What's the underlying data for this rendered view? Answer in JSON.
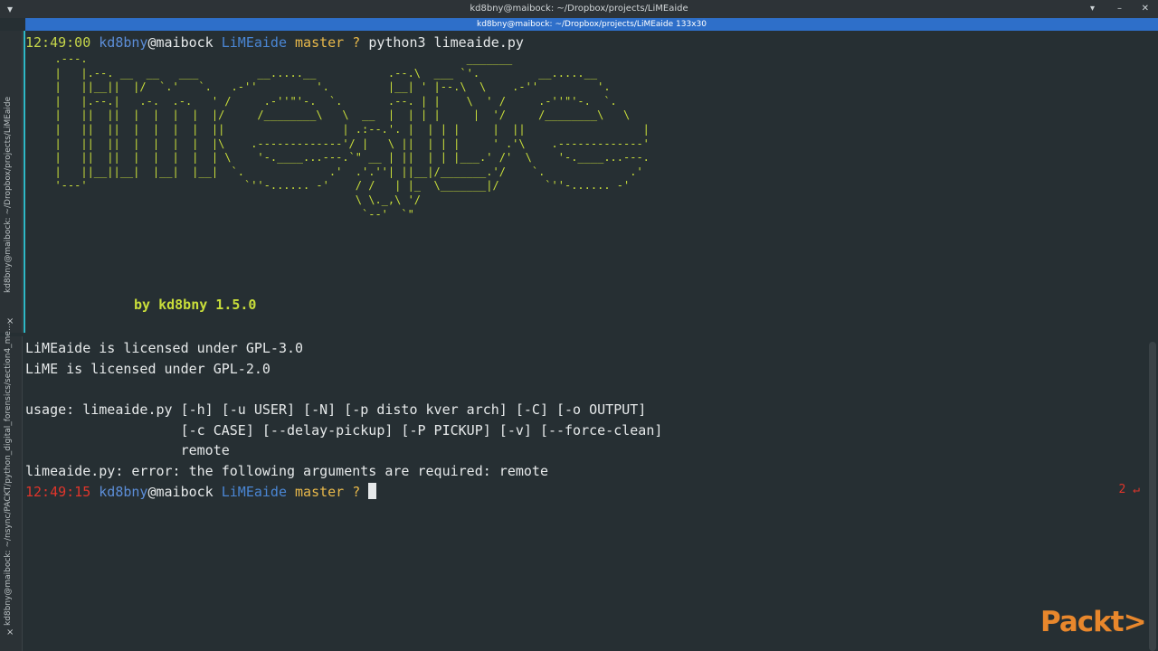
{
  "window": {
    "title": "kd8bny@maibock: ~/Dropbox/projects/LiMEaide",
    "controls": [
      "▾",
      "–",
      "✕"
    ]
  },
  "tab": {
    "title": "kd8bny@maibock: ~/Dropbox/projects/LiMEaide 133x30"
  },
  "sidebar": {
    "top_label": "kd8bny@maibock: ~/Dropbox/projects/LiMEaide",
    "bottom_label": "kd8bny@maibock: ~/nsync/PACKT/python_digital_forensics/section4_me...",
    "close_glyph": "×"
  },
  "prompt1": {
    "time": "12:49:00",
    "user": "kd8bny",
    "at_host": "@maibock",
    "dir": "LiMEaide",
    "branch": "master",
    "status": "?",
    "command": "python3 limeaide.py"
  },
  "banner": {
    "ascii": "  .---.                                                          _______\n  |   |.--. __  __   ___         __.....__           .--.\\  ___ `'.         __.....__\n  |   ||__||  |/  `.'   `.   .-''         '.         |__| ' |--.\\  \\    .-''         '.\n  |   |.--.|   .-.  .-.   ' /     .-''\"'-.  `.       .--. | |    \\  ' /     .-''\"'-.  `.\n  |   ||  ||  |  |  |  |  |/     /________\\   \\  __  |  | | |     |  '/     /________\\   \\\n  |   ||  ||  |  |  |  |  ||                  | .:--.'. |  | | |     |  ||                  |\n  |   ||  ||  |  |  |  |  |\\    .-------------'/ |   \\ ||  | | |     ' .'\\    .-------------'\n  |   ||  ||  |  |  |  |  | \\    '-.____...---.`\" __ | ||  | | |___.' /'  \\    '-.____...---.\n  |   ||__||__|  |__|  |__|  `.             .'  .'.''| ||__|/_______.'/    `.             .'\n  '---'                        `''-...... -'    / /   | |_  \\_______|/       `''-...... -'\n                                                \\ \\._,\\ '/\n                                                 `--'  `\"",
    "byline": "by kd8bny 1.5.0"
  },
  "output": {
    "license1": "LiMEaide is licensed under GPL-3.0",
    "license2": "LiME is licensed under GPL-2.0",
    "usage1": "usage: limeaide.py [-h] [-u USER] [-N] [-p disto kver arch] [-C] [-o OUTPUT]",
    "usage2": "                   [-c CASE] [--delay-pickup] [-P PICKUP] [-v] [--force-clean]",
    "usage3": "                   remote",
    "error": "limeaide.py: error: the following arguments are required: remote"
  },
  "prompt2": {
    "time": "12:49:15",
    "user": "kd8bny",
    "at_host": "@maibock",
    "dir": "LiMEaide",
    "branch": "master",
    "status": "?",
    "exit_code": "2 ↵"
  },
  "watermark": {
    "logo_text": "Packt>"
  },
  "colors": {
    "background": "#262f33",
    "tab_active": "#2e6fc9",
    "ascii_green": "#c9de3a",
    "time_ok": "#c6d64a",
    "time_error": "#e0352b",
    "user_blue": "#5c8ed8",
    "branch_yellow": "#e8b84a",
    "logo_orange": "#e8872c"
  }
}
